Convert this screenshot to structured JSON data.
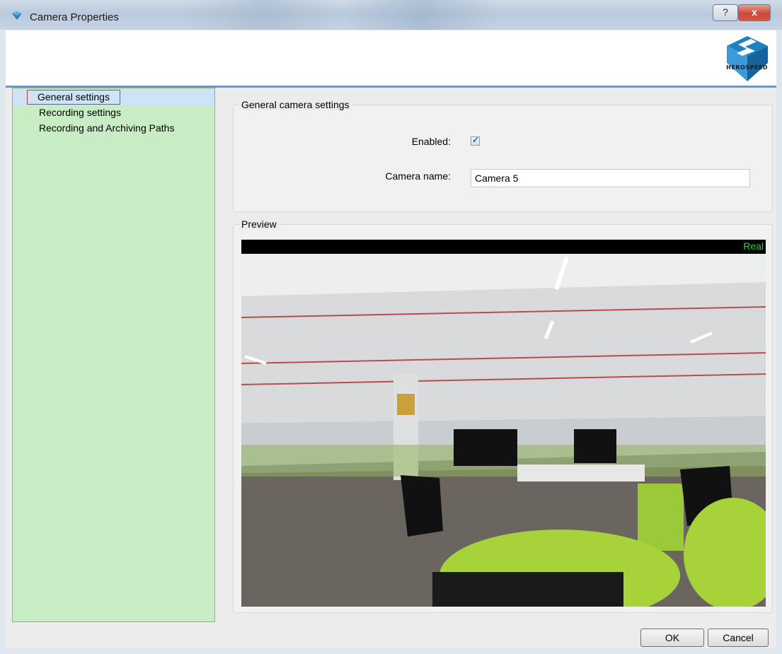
{
  "window": {
    "title": "Camera Properties",
    "help_glyph": "?",
    "close_glyph": "x"
  },
  "header": {
    "logo_text": "HEROSPEED"
  },
  "sidebar": {
    "items": [
      {
        "label": "General settings",
        "selected": true
      },
      {
        "label": "Recording settings",
        "selected": false
      },
      {
        "label": "Recording and Archiving Paths",
        "selected": false
      }
    ]
  },
  "general": {
    "group_title": "General camera settings",
    "enabled_label": "Enabled:",
    "enabled_checked": true,
    "camera_name_label": "Camera name:",
    "camera_name_value": "Camera 5"
  },
  "preview": {
    "group_title": "Preview",
    "overlay_text": "Real"
  },
  "buttons": {
    "ok": "OK",
    "cancel": "Cancel"
  },
  "colors": {
    "sidebar_bg": "#c8ecc4",
    "selection_outline": "#d23a3a",
    "header_accent": "#5a9bd8",
    "overlay_text": "#2ecc40"
  }
}
